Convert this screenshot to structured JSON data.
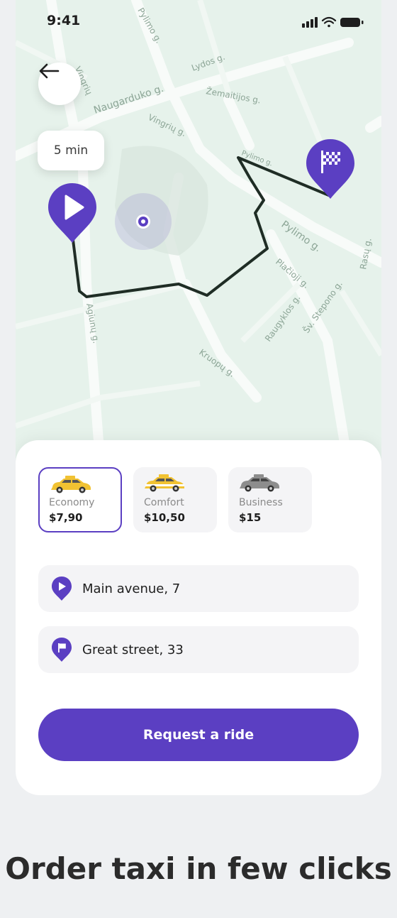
{
  "status": {
    "time": "9:41"
  },
  "map": {
    "eta": "5 min",
    "street_labels": [
      "Pylimo g.",
      "Naugarduko g.",
      "Vingrių",
      "Lydos g.",
      "Žemaitijos g.",
      "Vingrių g.",
      "Pylimo g.",
      "Šv. Stepono g.",
      "Rasų g.",
      "Raugyklos g.",
      "Kruopų g.",
      "Agiunų g.",
      "Pylimo g.",
      "Plačioji g."
    ]
  },
  "rides": [
    {
      "name": "Economy",
      "price": "$7,90",
      "selected": true,
      "color": "#f1c232"
    },
    {
      "name": "Comfort",
      "price": "$10,50",
      "selected": false,
      "color": "#f1c232"
    },
    {
      "name": "Business",
      "price": "$15",
      "selected": false,
      "color": "#8d8d8d"
    }
  ],
  "route": {
    "from": "Main avenue, 7",
    "to": "Great street, 33"
  },
  "request_label": "Request a ride",
  "headline": "Order taxi in few clicks",
  "colors": {
    "accent": "#5b3fc2",
    "map": "#e6f2eb",
    "route": "#1f2d25"
  }
}
